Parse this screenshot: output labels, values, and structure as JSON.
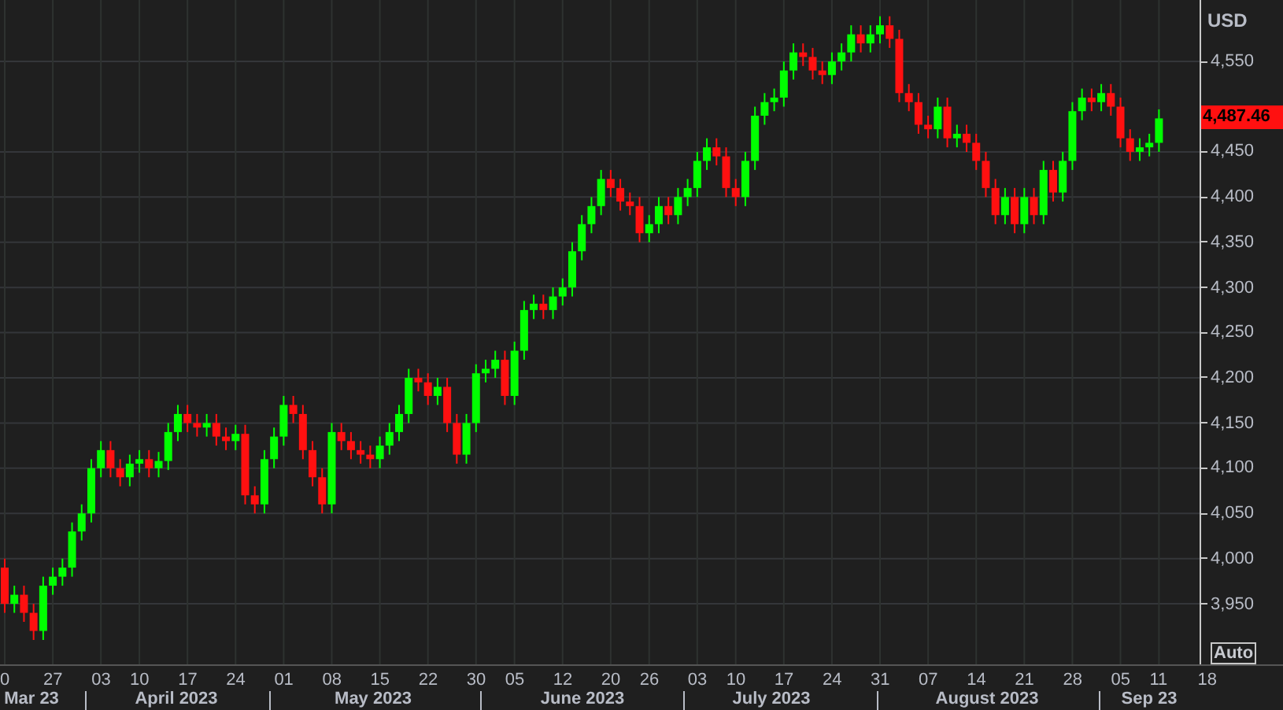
{
  "price_axis": {
    "currency": "USD",
    "price_badge": "4,487.46",
    "auto_button": "Auto"
  },
  "chart_data": {
    "type": "candlestick",
    "categories": [
      null,
      null,
      null,
      null,
      null,
      null,
      null,
      null,
      null,
      null,
      null,
      null,
      null,
      null,
      null,
      null,
      null,
      null,
      null,
      null,
      null,
      null,
      null,
      null,
      null,
      null,
      null,
      null,
      null,
      null,
      null,
      null,
      null,
      null,
      null,
      null,
      null,
      null,
      null,
      null,
      null,
      null,
      null,
      null,
      null,
      null,
      null,
      null,
      null,
      null,
      null,
      null,
      null,
      null,
      null,
      null,
      null,
      null,
      null,
      null,
      null,
      null,
      null,
      null,
      null,
      null,
      null,
      null,
      null,
      null,
      null,
      null,
      null,
      null,
      null,
      null,
      null,
      null,
      null,
      null,
      null,
      null,
      null,
      null,
      null,
      null,
      null,
      null,
      null,
      null,
      null,
      null,
      null,
      null,
      null,
      null,
      null,
      null,
      null,
      null,
      null,
      null,
      null,
      null,
      null,
      null,
      null,
      null,
      null,
      null,
      null,
      null,
      null,
      null,
      null,
      null,
      null,
      null,
      null,
      null,
      null,
      null,
      null,
      null,
      null,
      null
    ],
    "ylim": [
      3883,
      4618
    ],
    "grid": true,
    "yticks": [
      {
        "value": 4550,
        "label": "4,550"
      },
      {
        "value": 4450,
        "label": "4,450"
      },
      {
        "value": 4400,
        "label": "4,400"
      },
      {
        "value": 4350,
        "label": "4,350"
      },
      {
        "value": 4300,
        "label": "4,300"
      },
      {
        "value": 4250,
        "label": "4,250"
      },
      {
        "value": 4200,
        "label": "4,200"
      },
      {
        "value": 4150,
        "label": "4,150"
      },
      {
        "value": 4100,
        "label": "4,100"
      },
      {
        "value": 4050,
        "label": "4,050"
      },
      {
        "value": 4000,
        "label": "4,000"
      },
      {
        "value": 3950,
        "label": "3,950"
      }
    ],
    "ohlc": [
      [
        3990,
        4000,
        3940,
        3950
      ],
      [
        3950,
        3970,
        3940,
        3960
      ],
      [
        3960,
        3970,
        3930,
        3940
      ],
      [
        3940,
        3950,
        3910,
        3920
      ],
      [
        3920,
        3980,
        3910,
        3970
      ],
      [
        3970,
        3990,
        3960,
        3980
      ],
      [
        3980,
        4000,
        3970,
        3990
      ],
      [
        3990,
        4040,
        3980,
        4030
      ],
      [
        4030,
        4060,
        4020,
        4050
      ],
      [
        4050,
        4110,
        4040,
        4100
      ],
      [
        4100,
        4130,
        4090,
        4120
      ],
      [
        4120,
        4130,
        4090,
        4100
      ],
      [
        4100,
        4110,
        4080,
        4090
      ],
      [
        4090,
        4115,
        4080,
        4105
      ],
      [
        4105,
        4120,
        4095,
        4110
      ],
      [
        4110,
        4120,
        4090,
        4100
      ],
      [
        4100,
        4118,
        4090,
        4108
      ],
      [
        4108,
        4150,
        4098,
        4140
      ],
      [
        4140,
        4170,
        4130,
        4160
      ],
      [
        4160,
        4170,
        4140,
        4150
      ],
      [
        4150,
        4160,
        4135,
        4145
      ],
      [
        4145,
        4160,
        4135,
        4150
      ],
      [
        4150,
        4160,
        4125,
        4135
      ],
      [
        4135,
        4145,
        4120,
        4130
      ],
      [
        4130,
        4148,
        4120,
        4138
      ],
      [
        4138,
        4148,
        4060,
        4070
      ],
      [
        4070,
        4080,
        4050,
        4060
      ],
      [
        4060,
        4120,
        4050,
        4110
      ],
      [
        4110,
        4145,
        4100,
        4135
      ],
      [
        4135,
        4180,
        4125,
        4170
      ],
      [
        4170,
        4180,
        4150,
        4160
      ],
      [
        4160,
        4170,
        4110,
        4120
      ],
      [
        4120,
        4130,
        4080,
        4090
      ],
      [
        4090,
        4100,
        4050,
        4060
      ],
      [
        4060,
        4150,
        4050,
        4140
      ],
      [
        4140,
        4150,
        4120,
        4130
      ],
      [
        4130,
        4140,
        4110,
        4120
      ],
      [
        4120,
        4130,
        4105,
        4115
      ],
      [
        4115,
        4125,
        4100,
        4110
      ],
      [
        4110,
        4135,
        4100,
        4125
      ],
      [
        4125,
        4150,
        4115,
        4140
      ],
      [
        4140,
        4170,
        4130,
        4160
      ],
      [
        4160,
        4210,
        4150,
        4200
      ],
      [
        4200,
        4210,
        4185,
        4195
      ],
      [
        4195,
        4205,
        4170,
        4180
      ],
      [
        4180,
        4200,
        4170,
        4190
      ],
      [
        4190,
        4200,
        4140,
        4150
      ],
      [
        4150,
        4160,
        4105,
        4115
      ],
      [
        4115,
        4160,
        4105,
        4150
      ],
      [
        4150,
        4215,
        4140,
        4205
      ],
      [
        4205,
        4220,
        4195,
        4210
      ],
      [
        4210,
        4230,
        4200,
        4220
      ],
      [
        4220,
        4230,
        4170,
        4180
      ],
      [
        4180,
        4240,
        4170,
        4230
      ],
      [
        4230,
        4285,
        4220,
        4275
      ],
      [
        4275,
        4292,
        4265,
        4282
      ],
      [
        4282,
        4292,
        4265,
        4275
      ],
      [
        4275,
        4300,
        4265,
        4290
      ],
      [
        4290,
        4310,
        4280,
        4300
      ],
      [
        4300,
        4350,
        4290,
        4340
      ],
      [
        4340,
        4380,
        4330,
        4370
      ],
      [
        4370,
        4400,
        4360,
        4390
      ],
      [
        4390,
        4430,
        4380,
        4420
      ],
      [
        4420,
        4430,
        4400,
        4410
      ],
      [
        4410,
        4420,
        4385,
        4395
      ],
      [
        4395,
        4405,
        4380,
        4390
      ],
      [
        4390,
        4400,
        4350,
        4360
      ],
      [
        4360,
        4380,
        4350,
        4370
      ],
      [
        4370,
        4400,
        4360,
        4390
      ],
      [
        4390,
        4400,
        4370,
        4380
      ],
      [
        4380,
        4410,
        4370,
        4400
      ],
      [
        4400,
        4420,
        4390,
        4410
      ],
      [
        4410,
        4450,
        4400,
        4440
      ],
      [
        4440,
        4465,
        4430,
        4455
      ],
      [
        4455,
        4465,
        4435,
        4445
      ],
      [
        4445,
        4455,
        4400,
        4410
      ],
      [
        4410,
        4420,
        4390,
        4400
      ],
      [
        4400,
        4450,
        4390,
        4440
      ],
      [
        4440,
        4500,
        4430,
        4490
      ],
      [
        4490,
        4515,
        4480,
        4505
      ],
      [
        4505,
        4520,
        4495,
        4510
      ],
      [
        4510,
        4550,
        4500,
        4540
      ],
      [
        4540,
        4570,
        4530,
        4560
      ],
      [
        4560,
        4570,
        4545,
        4555
      ],
      [
        4555,
        4565,
        4530,
        4540
      ],
      [
        4540,
        4550,
        4525,
        4535
      ],
      [
        4535,
        4560,
        4525,
        4550
      ],
      [
        4550,
        4570,
        4540,
        4560
      ],
      [
        4560,
        4590,
        4550,
        4580
      ],
      [
        4580,
        4590,
        4560,
        4570
      ],
      [
        4570,
        4590,
        4560,
        4580
      ],
      [
        4580,
        4600,
        4570,
        4590
      ],
      [
        4590,
        4600,
        4565,
        4575
      ],
      [
        4575,
        4585,
        4505,
        4515
      ],
      [
        4515,
        4525,
        4495,
        4505
      ],
      [
        4505,
        4515,
        4470,
        4480
      ],
      [
        4480,
        4490,
        4465,
        4475
      ],
      [
        4475,
        4510,
        4465,
        4500
      ],
      [
        4500,
        4510,
        4455,
        4465
      ],
      [
        4465,
        4480,
        4455,
        4470
      ],
      [
        4470,
        4480,
        4450,
        4460
      ],
      [
        4460,
        4470,
        4430,
        4440
      ],
      [
        4440,
        4450,
        4400,
        4410
      ],
      [
        4410,
        4420,
        4370,
        4380
      ],
      [
        4380,
        4410,
        4370,
        4400
      ],
      [
        4400,
        4410,
        4360,
        4370
      ],
      [
        4370,
        4410,
        4360,
        4400
      ],
      [
        4400,
        4410,
        4370,
        4380
      ],
      [
        4380,
        4440,
        4370,
        4430
      ],
      [
        4430,
        4440,
        4395,
        4405
      ],
      [
        4405,
        4450,
        4395,
        4440
      ],
      [
        4440,
        4505,
        4430,
        4495
      ],
      [
        4495,
        4520,
        4485,
        4510
      ],
      [
        4510,
        4520,
        4495,
        4505
      ],
      [
        4505,
        4525,
        4495,
        4515
      ],
      [
        4515,
        4525,
        4490,
        4500
      ],
      [
        4500,
        4510,
        4455,
        4465
      ],
      [
        4465,
        4475,
        4440,
        4450
      ],
      [
        4450,
        4465,
        4440,
        4455
      ],
      [
        4455,
        4470,
        4445,
        4460
      ],
      [
        4460,
        4497,
        4450,
        4487
      ],
      null,
      null,
      null,
      null,
      null
    ]
  },
  "time_axis": {
    "days": [
      "0",
      "27",
      "03",
      "10",
      "17",
      "24",
      "01",
      "08",
      "15",
      "22",
      "30",
      "05",
      "12",
      "20",
      "26",
      "03",
      "10",
      "17",
      "24",
      "31",
      "07",
      "14",
      "21",
      "28",
      "05",
      "11",
      "18"
    ],
    "months": [
      "Mar 23",
      "April 2023",
      "May 2023",
      "June 2023",
      "July 2023",
      "August 2023",
      "Sep 23"
    ]
  }
}
